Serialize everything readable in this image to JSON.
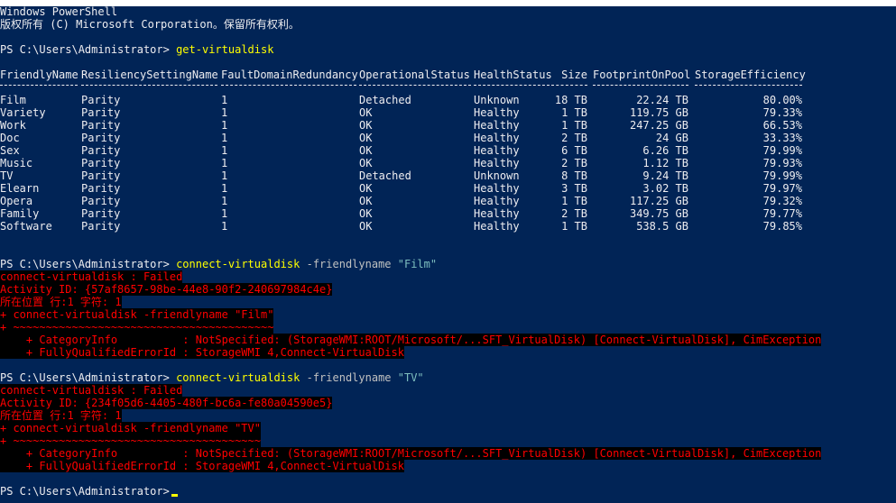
{
  "header": {
    "title": "Windows PowerShell",
    "copyright": "版权所有 (C) Microsoft Corporation。保留所有权利。"
  },
  "session": {
    "prompt": "PS C:\\Users\\Administrator>",
    "command1": "get-virtualdisk",
    "cmd2": {
      "name": "connect-virtualdisk",
      "param": "-friendlyname",
      "arg": "\"Film\""
    },
    "cmd3": {
      "name": "connect-virtualdisk",
      "param": "-friendlyname",
      "arg": "\"TV\""
    }
  },
  "table": {
    "columns": [
      "FriendlyName",
      "ResiliencySettingName",
      "FaultDomainRedundancy",
      "OperationalStatus",
      "HealthStatus",
      "Size",
      "FootprintOnPool",
      "StorageEfficiency"
    ],
    "rows": [
      [
        "Film",
        "Parity",
        "1",
        "Detached",
        "Unknown",
        "18 TB",
        "22.24 TB",
        "80.00%"
      ],
      [
        "Variety",
        "Parity",
        "1",
        "OK",
        "Healthy",
        "1 TB",
        "119.75 GB",
        "79.33%"
      ],
      [
        "Work",
        "Parity",
        "1",
        "OK",
        "Healthy",
        "1 TB",
        "247.25 GB",
        "66.53%"
      ],
      [
        "Doc",
        "Parity",
        "1",
        "OK",
        "Healthy",
        "2 TB",
        "24 GB",
        "33.33%"
      ],
      [
        "Sex",
        "Parity",
        "1",
        "OK",
        "Healthy",
        "6 TB",
        "6.26 TB",
        "79.99%"
      ],
      [
        "Music",
        "Parity",
        "1",
        "OK",
        "Healthy",
        "2 TB",
        "1.12 TB",
        "79.93%"
      ],
      [
        "TV",
        "Parity",
        "1",
        "Detached",
        "Unknown",
        "8 TB",
        "9.24 TB",
        "79.99%"
      ],
      [
        "Elearn",
        "Parity",
        "1",
        "OK",
        "Healthy",
        "3 TB",
        "3.02 TB",
        "79.97%"
      ],
      [
        "Opera",
        "Parity",
        "1",
        "OK",
        "Healthy",
        "1 TB",
        "117.25 GB",
        "79.32%"
      ],
      [
        "Family",
        "Parity",
        "1",
        "OK",
        "Healthy",
        "2 TB",
        "349.75 GB",
        "79.77%"
      ],
      [
        "Software",
        "Parity",
        "1",
        "OK",
        "Healthy",
        "1 TB",
        "538.5 GB",
        "79.85%"
      ]
    ]
  },
  "errors": [
    {
      "l1": "connect-virtualdisk : Failed",
      "l2": "Activity ID: {57af8657-98be-44e8-90f2-240697984c4e}",
      "l3": "所在位置 行:1 字符: 1",
      "l4": "+ connect-virtualdisk -friendlyname \"Film\"",
      "l5": "+ ~~~~~~~~~~~~~~~~~~~~~~~~~~~~~~~~~~~~~~~~",
      "l6": "    + CategoryInfo          : NotSpecified: (StorageWMI:ROOT/Microsoft/...SFT_VirtualDisk) [Connect-VirtualDisk], CimException",
      "l7": "    + FullyQualifiedErrorId : StorageWMI 4,Connect-VirtualDisk"
    },
    {
      "l1": "connect-virtualdisk : Failed",
      "l2": "Activity ID: {234f05d6-4405-480f-bc6a-fe80a04590e5}",
      "l3": "所在位置 行:1 字符: 1",
      "l4": "+ connect-virtualdisk -friendlyname \"TV\"",
      "l5": "+ ~~~~~~~~~~~~~~~~~~~~~~~~~~~~~~~~~~~~~~",
      "l6": "    + CategoryInfo          : NotSpecified: (StorageWMI:ROOT/Microsoft/...SFT_VirtualDisk) [Connect-VirtualDisk], CimException",
      "l7": "    + FullyQualifiedErrorId : StorageWMI 4,Connect-VirtualDisk"
    }
  ],
  "colors": {
    "background": "#012456",
    "foreground": "#eeedf0",
    "command": "#ffff00",
    "error_text": "#ff0000",
    "error_bg": "#000000"
  }
}
